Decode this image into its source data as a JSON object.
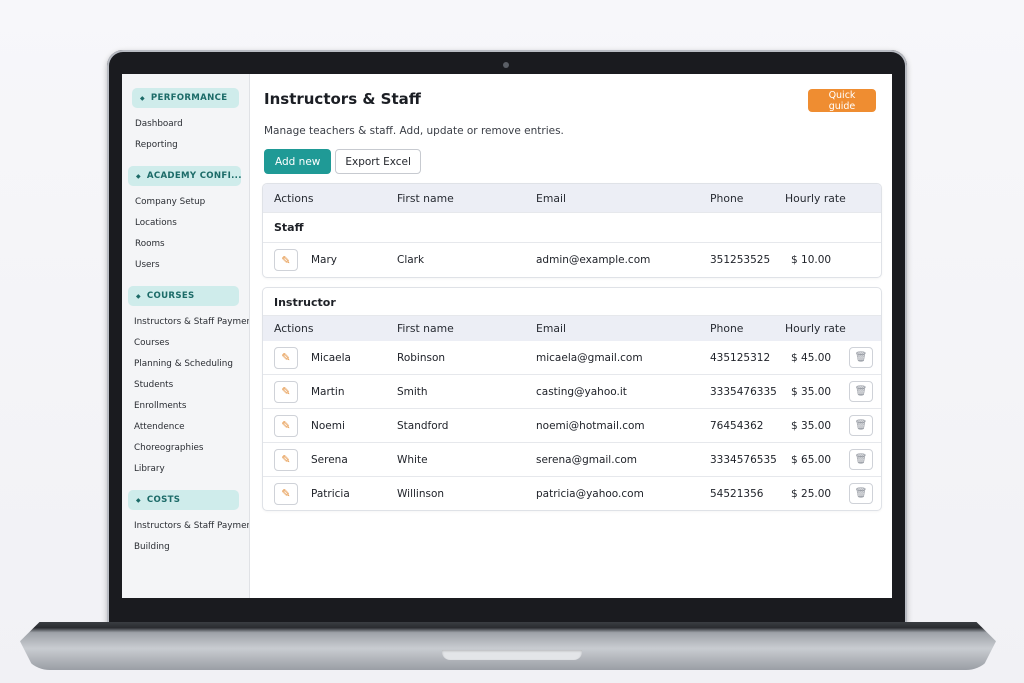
{
  "sidebar": {
    "groups": [
      {
        "header": "PERFORMANCE",
        "items": [
          "Dashboard",
          "Reporting"
        ]
      },
      {
        "header": "ACADEMY CONFI...",
        "items": [
          "Company Setup",
          "Locations",
          "Rooms",
          "Users"
        ]
      },
      {
        "header": "COURSES",
        "items": [
          "Instructors & Staff Paymens",
          "Courses",
          "Planning & Scheduling",
          "Students",
          "Enrollments",
          "Attendence",
          "Choreographies",
          "Library"
        ]
      },
      {
        "header": "COSTS",
        "items": [
          "Instructors & Staff Payments",
          "Building"
        ]
      }
    ]
  },
  "main": {
    "title": "Instructors & Staff",
    "subtitle": "Manage teachers & staff. Add, update or remove entries.",
    "quick_guide": "Quick guide",
    "add_new": "Add new",
    "export_excel": "Export Excel"
  },
  "columns": {
    "actions": "Actions",
    "first_name": "First name",
    "email": "Email",
    "phone": "Phone",
    "hourly_rate": "Hourly rate"
  },
  "staff": {
    "label": "Staff",
    "rows": [
      {
        "name": "Mary",
        "first": "Clark",
        "email": "admin@example.com",
        "phone": "351253525",
        "rate": "$ 10.00"
      }
    ]
  },
  "instructor": {
    "label": "Instructor",
    "rows": [
      {
        "name": "Micaela",
        "first": "Robinson",
        "email": "micaela@gmail.com",
        "phone": "435125312",
        "rate": "$ 45.00"
      },
      {
        "name": "Martin",
        "first": "Smith",
        "email": "casting@yahoo.it",
        "phone": "3335476335",
        "rate": "$ 35.00"
      },
      {
        "name": "Noemi",
        "first": "Standford",
        "email": "noemi@hotmail.com",
        "phone": "76454362",
        "rate": "$ 35.00"
      },
      {
        "name": "Serena",
        "first": "White",
        "email": "serena@gmail.com",
        "phone": "3334576535",
        "rate": "$ 65.00"
      },
      {
        "name": "Patricia",
        "first": "Willinson",
        "email": "patricia@yahoo.com",
        "phone": "54521356",
        "rate": "$ 25.00"
      }
    ]
  },
  "colors": {
    "accent": "#1f9a96",
    "quick_guide": "#ef8d31",
    "sidebar_header": "#cfeceb"
  }
}
